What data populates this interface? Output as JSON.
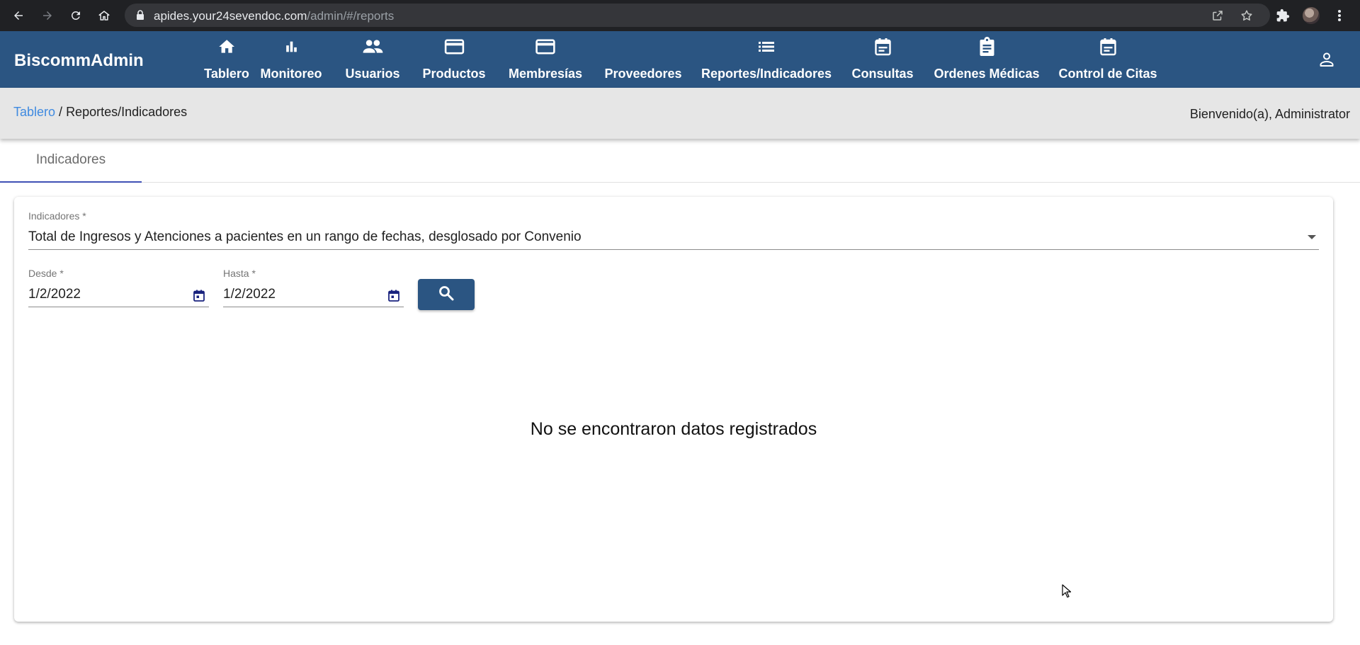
{
  "browser": {
    "url_host": "apides.your24sevendoc.com",
    "url_path": "/admin/#/reports"
  },
  "app": {
    "brand": "BiscommAdmin"
  },
  "nav": [
    {
      "label": "Tablero",
      "icon": "home-icon"
    },
    {
      "label": "Monitoreo",
      "icon": "bar-chart-icon"
    },
    {
      "label": "Usuarios",
      "icon": "people-icon"
    },
    {
      "label": "Productos",
      "icon": "credit-card-icon"
    },
    {
      "label": "Membresías",
      "icon": "credit-card-icon"
    },
    {
      "label": "Proveedores",
      "icon": ""
    },
    {
      "label": "Reportes/Indicadores",
      "icon": "list-icon"
    },
    {
      "label": "Consultas",
      "icon": "calendar-icon"
    },
    {
      "label": "Ordenes Médicas",
      "icon": "clipboard-icon"
    },
    {
      "label": "Control de Citas",
      "icon": "calendar-icon"
    }
  ],
  "breadcrumb": {
    "home": "Tablero",
    "separator": " / ",
    "current": "Reportes/Indicadores"
  },
  "welcome": "Bienvenido(a), Administrator",
  "tabs": [
    {
      "label": "Indicadores",
      "active": true
    }
  ],
  "form": {
    "indicator_label": "Indicadores *",
    "indicator_value": "Total de Ingresos y Atenciones a pacientes en un rango de fechas, desglosado por Convenio",
    "from_label": "Desde *",
    "from_value": "1/2/2022",
    "to_label": "Hasta *",
    "to_value": "1/2/2022"
  },
  "empty_message": "No se encontraron datos registrados",
  "colors": {
    "primary": "#2b5582",
    "link": "#3f8ae0",
    "tab_indicator": "#3f51b5",
    "calendar_icon": "#1a237e"
  }
}
